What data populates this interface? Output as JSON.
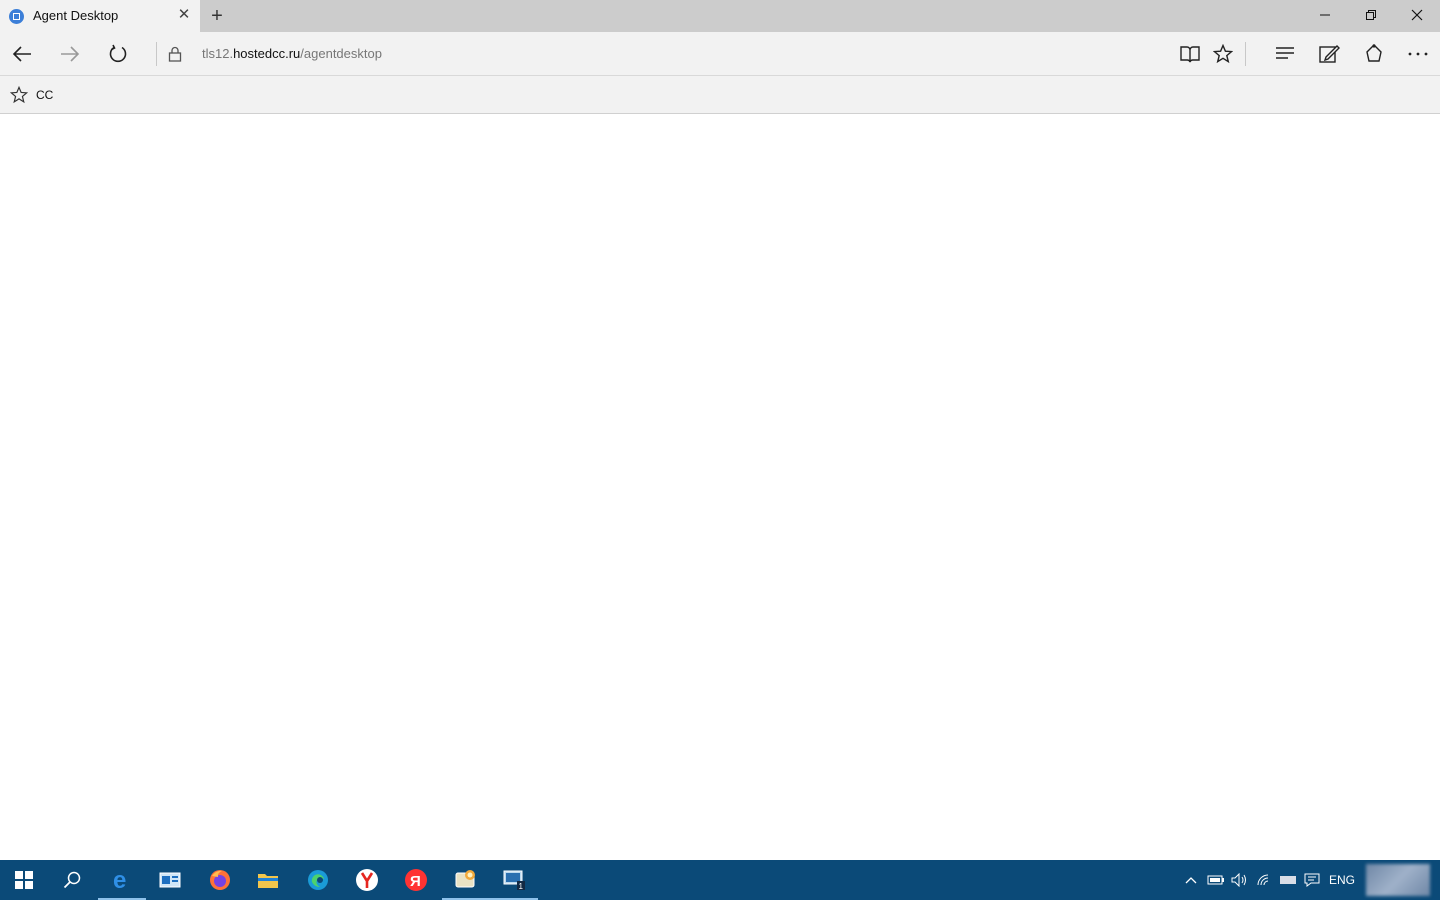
{
  "browser": {
    "tab": {
      "title": "Agent Desktop"
    },
    "address": {
      "prefix": "tls12.",
      "host": "hostedcc.ru",
      "path": "/agentdesktop"
    },
    "favorites": [
      {
        "label": "CC"
      }
    ]
  },
  "taskbar": {
    "apps": [
      "start",
      "search",
      "edge-legacy",
      "outlook",
      "firefox",
      "file-explorer",
      "edge",
      "yandex-browser",
      "yandex",
      "app",
      "remote-desktop"
    ],
    "tray": {
      "language": "ENG"
    }
  },
  "colors": {
    "taskbar": "#0b4a78",
    "chrome": "#f2f2f2",
    "titlebar": "#cccccc"
  }
}
